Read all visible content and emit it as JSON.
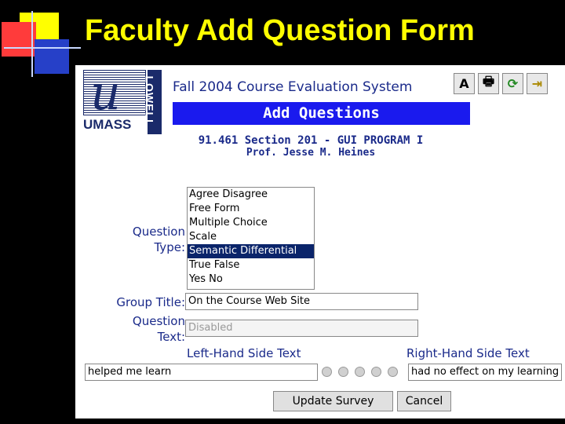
{
  "slide": {
    "title": "Faculty Add Question Form"
  },
  "header": {
    "logo_text": "UMASS",
    "logo_side": "LOWELL",
    "system_title": "Fall 2004 Course Evaluation System",
    "section_title": "Add Questions",
    "course": "91.461 Section 201 - GUI PROGRAM I",
    "professor": "Prof. Jesse M. Heines"
  },
  "toolbar": {
    "buttons": [
      {
        "name": "font-size-icon",
        "glyph": "A"
      },
      {
        "name": "printer-icon",
        "glyph": "🖶"
      },
      {
        "name": "refresh-icon",
        "glyph": "⟳"
      },
      {
        "name": "exit-door-icon",
        "glyph": "⇥"
      }
    ]
  },
  "form": {
    "question_type_label_1": "Question",
    "question_type_label_2": "Type:",
    "question_types": [
      "Agree Disagree",
      "Free Form",
      "Multiple Choice",
      "Scale",
      "Semantic Differential",
      "True False",
      "Yes No"
    ],
    "selected_type": "Semantic Differential",
    "group_title_label": "Group Title:",
    "group_title_value": "On the Course Web Site",
    "question_text_label_1": "Question",
    "question_text_label_2": "Text:",
    "question_text_value": "Disabled",
    "left_label": "Left-Hand Side Text",
    "right_label": "Right-Hand Side Text",
    "left_value": "helped me learn",
    "right_value": "had no effect on my learning",
    "radio_count": 5,
    "update_button": "Update Survey",
    "cancel_button": "Cancel"
  }
}
